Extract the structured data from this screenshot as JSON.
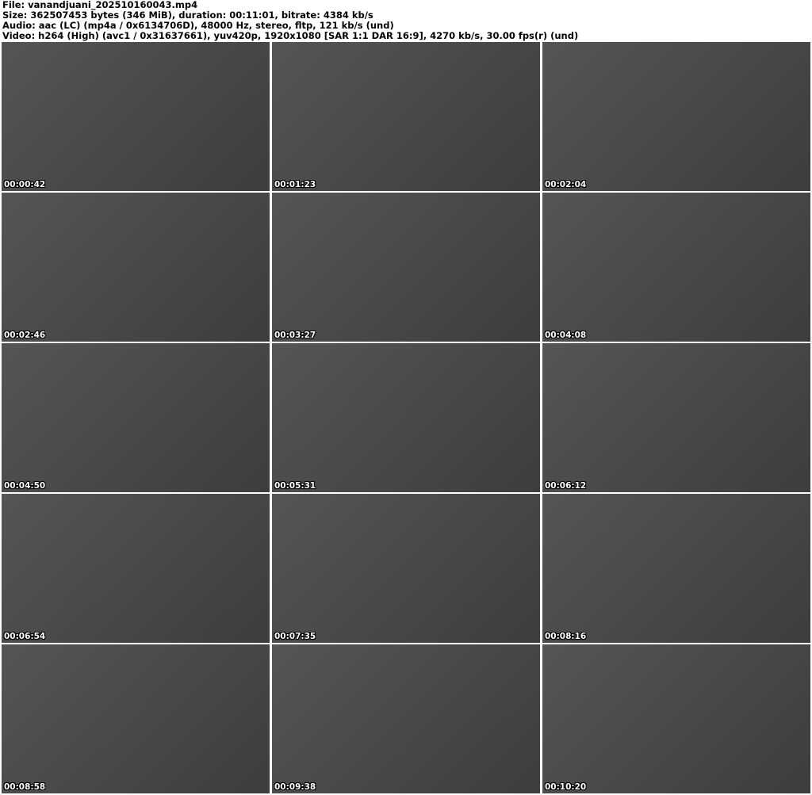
{
  "header": {
    "file": "File: vanandjuani_202510160043.mp4",
    "size": "Size: 362507453 bytes (346 MiB), duration: 00:11:01, bitrate: 4384 kb/s",
    "audio": "Audio: aac (LC) (mp4a / 0x6134706D), 48000 Hz, stereo, fltp, 121 kb/s (und)",
    "video": "Video: h264 (High) (avc1 / 0x31637661), yuv420p, 1920x1080 [SAR 1:1 DAR 16:9], 4270 kb/s, 30.00 fps(r) (und)"
  },
  "thumbnails": [
    "00:00:42",
    "00:01:23",
    "00:02:04",
    "00:02:46",
    "00:03:27",
    "00:04:08",
    "00:04:50",
    "00:05:31",
    "00:06:12",
    "00:06:54",
    "00:07:35",
    "00:08:16",
    "00:08:58",
    "00:09:38",
    "00:10:20"
  ]
}
